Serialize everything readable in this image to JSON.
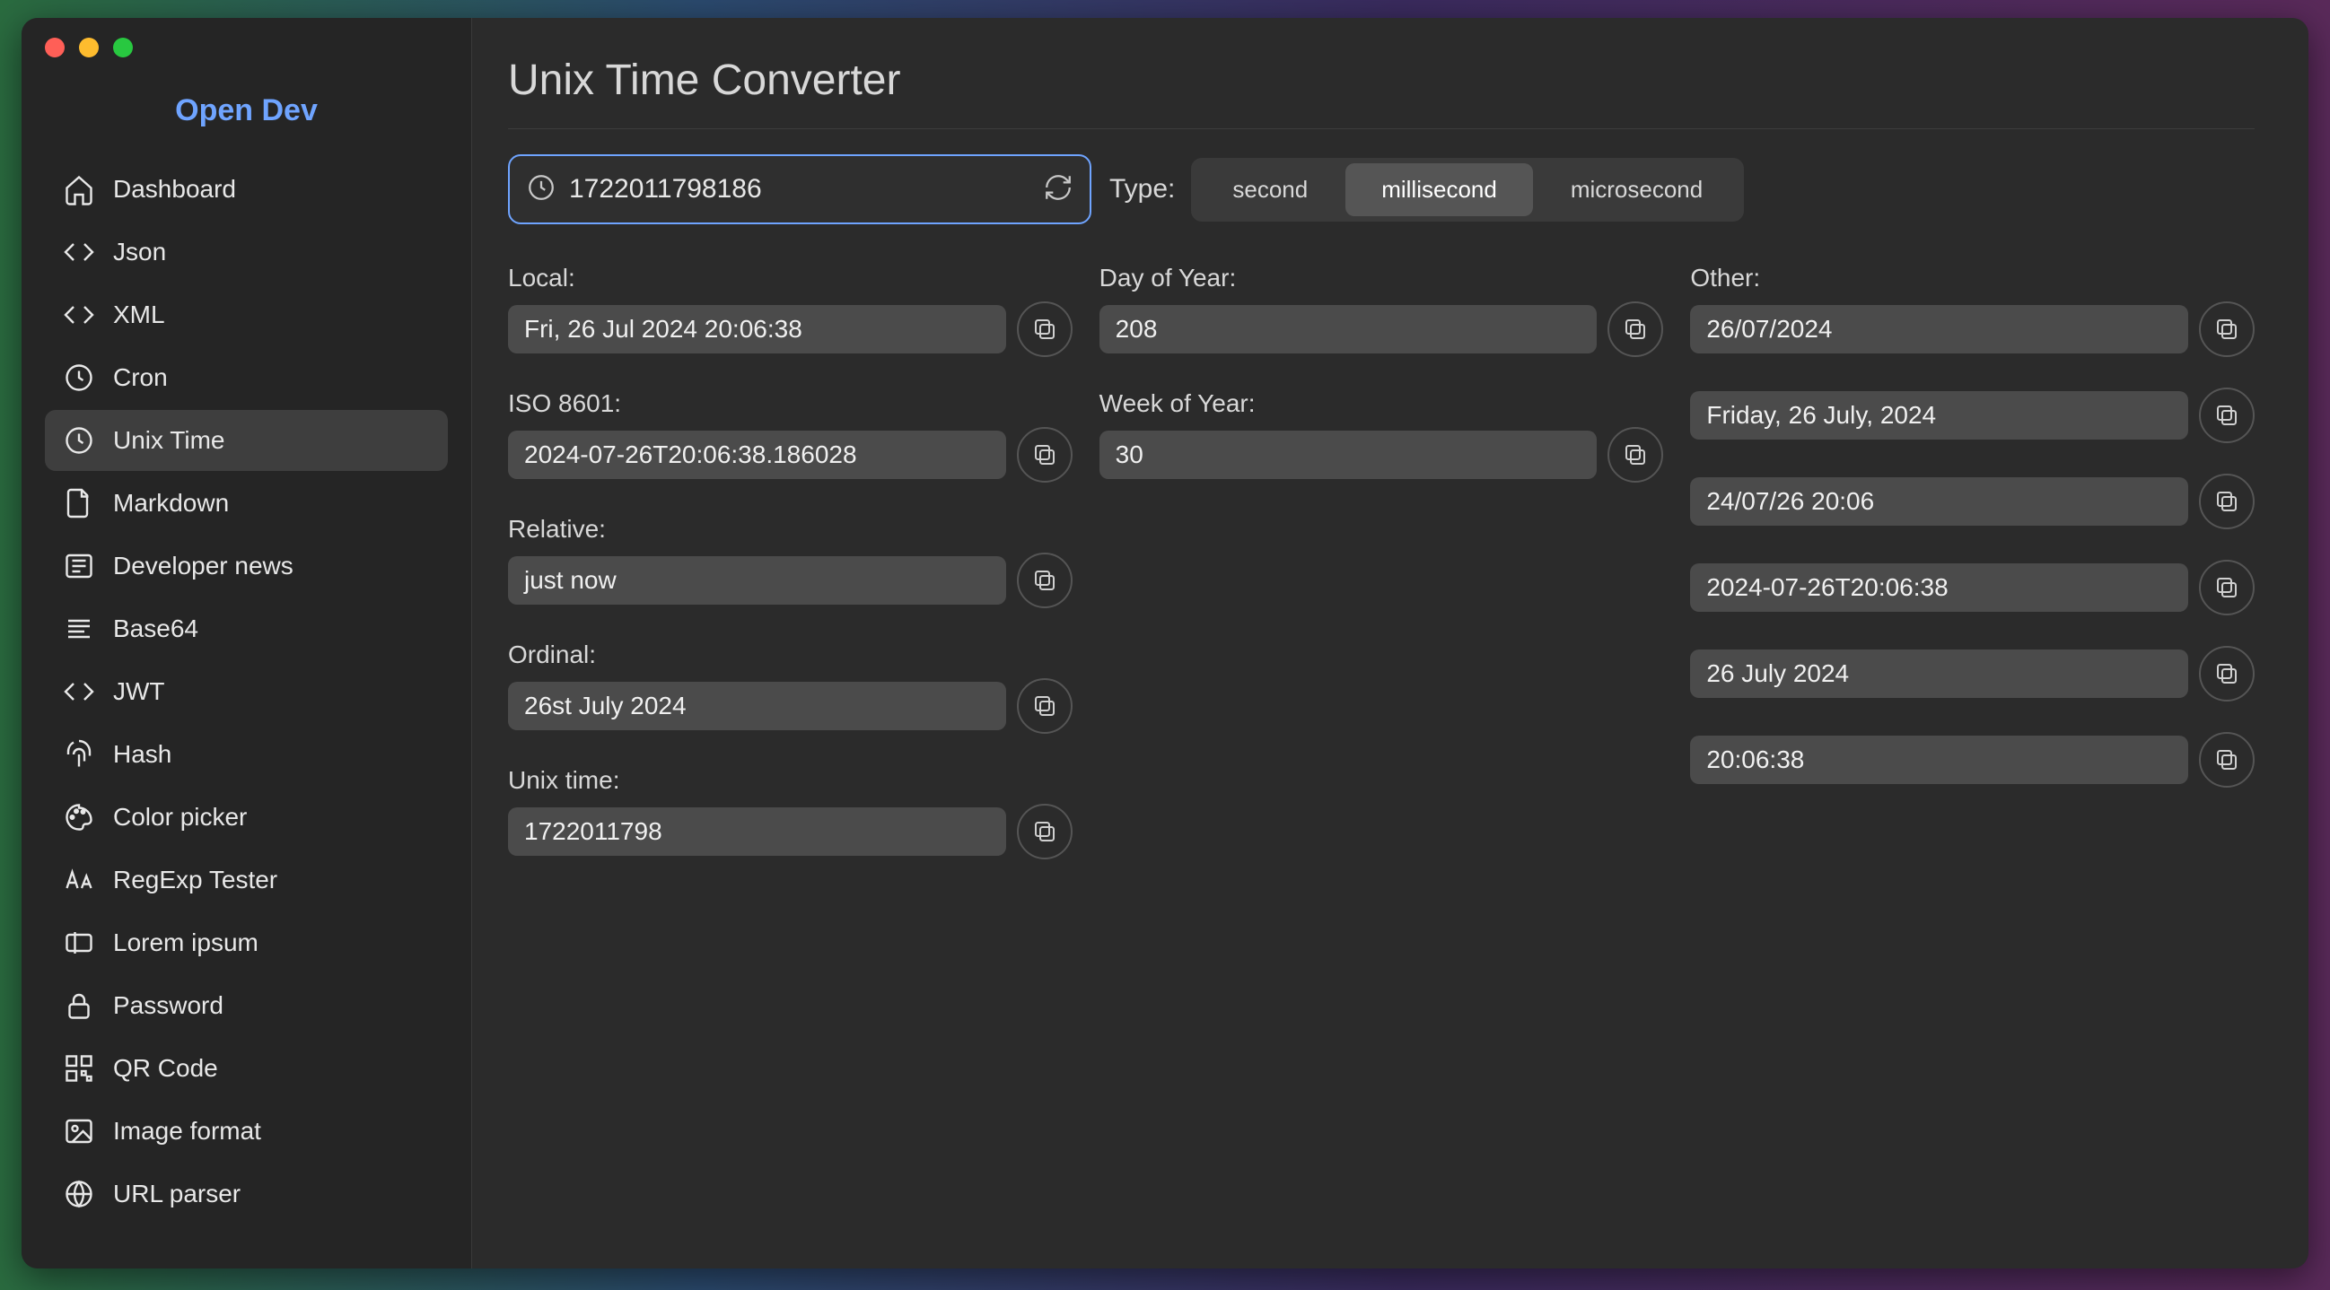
{
  "brand": "Open Dev",
  "sidebar": {
    "items": [
      {
        "label": "Dashboard",
        "icon": "home"
      },
      {
        "label": "Json",
        "icon": "code"
      },
      {
        "label": "XML",
        "icon": "code"
      },
      {
        "label": "Cron",
        "icon": "clock"
      },
      {
        "label": "Unix Time",
        "icon": "clock",
        "active": true
      },
      {
        "label": "Markdown",
        "icon": "file"
      },
      {
        "label": "Developer news",
        "icon": "news"
      },
      {
        "label": "Base64",
        "icon": "lines"
      },
      {
        "label": "JWT",
        "icon": "code"
      },
      {
        "label": "Hash",
        "icon": "fingerprint"
      },
      {
        "label": "Color picker",
        "icon": "palette"
      },
      {
        "label": "RegExp Tester",
        "icon": "aa"
      },
      {
        "label": "Lorem ipsum",
        "icon": "textbox"
      },
      {
        "label": "Password",
        "icon": "lock"
      },
      {
        "label": "QR Code",
        "icon": "qr"
      },
      {
        "label": "Image format",
        "icon": "image"
      },
      {
        "label": "URL parser",
        "icon": "globe"
      }
    ]
  },
  "page": {
    "title": "Unix Time Converter",
    "input_value": "1722011798186",
    "type_label": "Type:",
    "type_options": [
      "second",
      "millisecond",
      "microsecond"
    ],
    "type_selected": "millisecond",
    "col1": {
      "local": {
        "label": "Local:",
        "value": "Fri, 26 Jul 2024 20:06:38"
      },
      "iso": {
        "label": "ISO 8601:",
        "value": "2024-07-26T20:06:38.186028"
      },
      "rel": {
        "label": "Relative:",
        "value": "just now"
      },
      "ord": {
        "label": "Ordinal:",
        "value": "26st July 2024"
      },
      "unix": {
        "label": "Unix time:",
        "value": "1722011798"
      }
    },
    "col2": {
      "doy": {
        "label": "Day of Year:",
        "value": "208"
      },
      "woy": {
        "label": "Week of Year:",
        "value": "30"
      }
    },
    "col3": {
      "label": "Other:",
      "values": [
        "26/07/2024",
        "Friday, 26 July, 2024",
        "24/07/26 20:06",
        "2024-07-26T20:06:38",
        "26 July 2024",
        "20:06:38"
      ]
    }
  }
}
